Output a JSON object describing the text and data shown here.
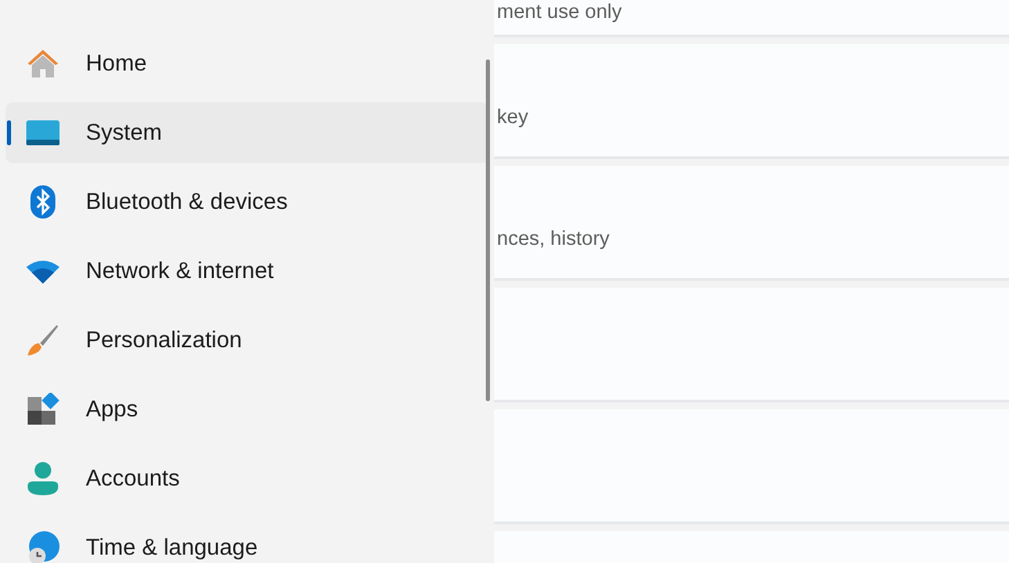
{
  "sidebar": {
    "items": [
      {
        "label": "Home",
        "selected": false
      },
      {
        "label": "System",
        "selected": true
      },
      {
        "label": "Bluetooth & devices",
        "selected": false
      },
      {
        "label": "Network & internet",
        "selected": false
      },
      {
        "label": "Personalization",
        "selected": false
      },
      {
        "label": "Apps",
        "selected": false
      },
      {
        "label": "Accounts",
        "selected": false
      },
      {
        "label": "Time & language",
        "selected": false
      }
    ]
  },
  "content": {
    "cards": [
      {
        "kind": "text",
        "description": "ment use only"
      },
      {
        "kind": "text",
        "description": "key"
      },
      {
        "kind": "text",
        "description": "nces, history"
      },
      {
        "kind": "blank"
      },
      {
        "kind": "blank"
      },
      {
        "kind": "blank"
      }
    ]
  }
}
